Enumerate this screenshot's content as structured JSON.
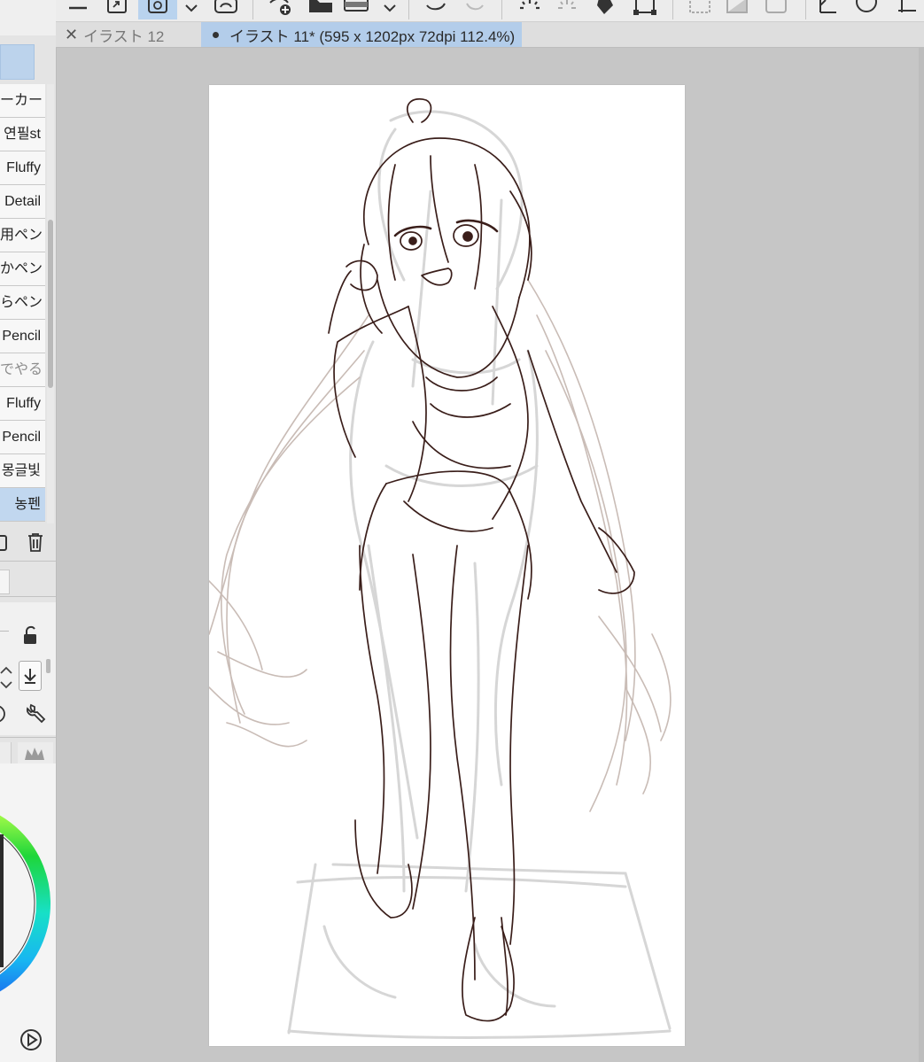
{
  "tabs": [
    {
      "label": "イラスト 12",
      "active": false
    },
    {
      "label": "イラスト 11* (595 x 1202px 72dpi 112.4%)",
      "active": true
    }
  ],
  "brushes": [
    {
      "label": "ーカー",
      "state": "normal"
    },
    {
      "label": "연필st",
      "state": "normal"
    },
    {
      "label": "Fluffy",
      "state": "normal"
    },
    {
      "label": "Detail",
      "state": "normal"
    },
    {
      "label": "用ペン",
      "state": "normal"
    },
    {
      "label": "かペン",
      "state": "normal"
    },
    {
      "label": "らペン",
      "state": "normal"
    },
    {
      "label": "Pencil",
      "state": "normal"
    },
    {
      "label": "でやる",
      "state": "faded"
    },
    {
      "label": "Fluffy",
      "state": "normal"
    },
    {
      "label": "Pencil",
      "state": "normal"
    },
    {
      "label": "몽글빛",
      "state": "normal"
    },
    {
      "label": "농펜",
      "state": "selected"
    }
  ],
  "icons": {
    "toolbar": [
      "menu-icon",
      "export-icon",
      "transform-icon",
      "dropdown-icon",
      "lasso-icon",
      "add-layer-icon",
      "folder-icon",
      "fill-layer-icon",
      "dropdown-icon",
      "undo-icon",
      "redo-icon",
      "loading-spinner-icon",
      "sparkle-icon",
      "fill-bucket-icon",
      "crop-icon",
      "select-icon",
      "gradient-icon",
      "frame-icon",
      "ruler-icon",
      "circle-icon",
      "perspective-icon"
    ],
    "left": [
      "new-brush-icon",
      "trash-icon",
      "lock-icon",
      "stepper-icon",
      "download-icon",
      "circle-tool-icon",
      "wrench-icon",
      "crown-icon",
      "play-icon"
    ]
  },
  "colors": {
    "accent": "#b3cdea",
    "sketch_line": "#3a1e1a",
    "rough_line": "#c9bcb6",
    "guide_gray": "#d8d8d8"
  }
}
